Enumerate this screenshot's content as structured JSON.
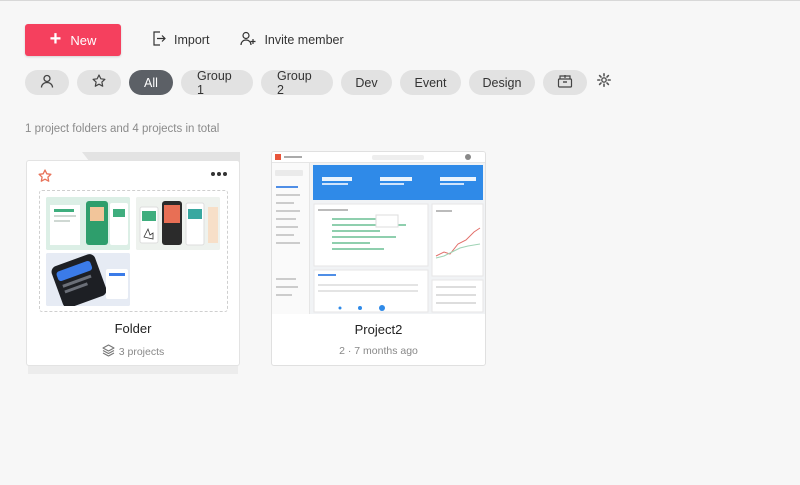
{
  "toolbar": {
    "new_label": "New",
    "import_label": "Import",
    "invite_label": "Invite member"
  },
  "filters": {
    "items": [
      {
        "icon": "person-icon"
      },
      {
        "icon": "star-icon"
      },
      {
        "label": "All",
        "active": true
      },
      {
        "label": "Group 1"
      },
      {
        "label": "Group 2"
      },
      {
        "label": "Dev"
      },
      {
        "label": "Event"
      },
      {
        "label": "Design"
      },
      {
        "icon": "archive-box-icon"
      }
    ],
    "settings_icon": "gear-icon"
  },
  "summary": "1 project folders and 4 projects in total",
  "folder": {
    "title": "Folder",
    "meta": "3 projects",
    "fav_icon": "star-outline-icon",
    "more_icon": "more-dots-icon"
  },
  "project": {
    "title": "Project2",
    "meta": "2 · 7 months ago"
  },
  "colors": {
    "accent": "#f5405e",
    "active_chip": "#5c6066",
    "chip": "#e2e2e2",
    "preview_blue": "#2f8ae8"
  }
}
